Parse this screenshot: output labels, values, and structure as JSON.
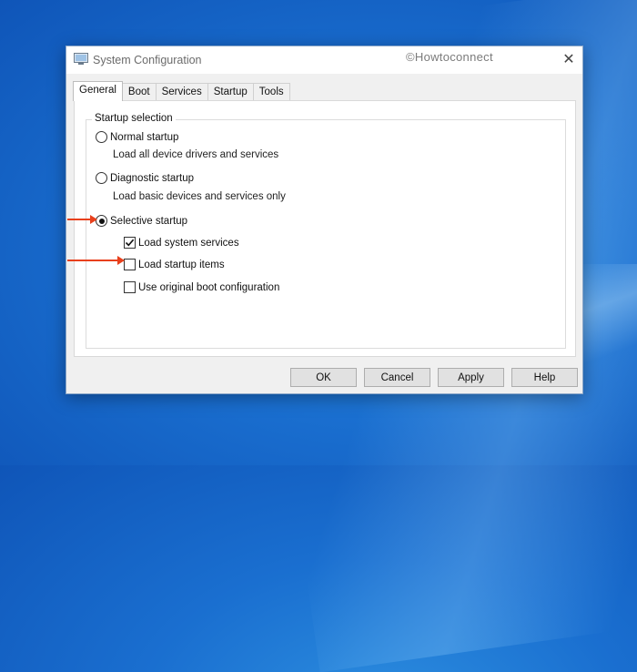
{
  "window": {
    "title": "System Configuration",
    "watermark": "©Howtoconnect",
    "close_glyph": "✕"
  },
  "tabs": [
    {
      "label": "General",
      "active": true
    },
    {
      "label": "Boot",
      "active": false
    },
    {
      "label": "Services",
      "active": false
    },
    {
      "label": "Startup",
      "active": false
    },
    {
      "label": "Tools",
      "active": false
    }
  ],
  "startup_selection": {
    "legend": "Startup selection",
    "normal": {
      "label": "Normal startup",
      "desc": "Load all device drivers and services",
      "checked": false
    },
    "diagnostic": {
      "label": "Diagnostic startup",
      "desc": "Load basic devices and services only",
      "checked": false
    },
    "selective": {
      "label": "Selective startup",
      "checked": true
    },
    "options": [
      {
        "label": "Load system services",
        "checked": true
      },
      {
        "label": "Load startup items",
        "checked": false
      },
      {
        "label": "Use original boot configuration",
        "checked": false
      }
    ]
  },
  "buttons": {
    "ok": "OK",
    "cancel": "Cancel",
    "apply": "Apply",
    "help": "Help"
  },
  "colors": {
    "arrow": "#e8401c",
    "desktop": "#1a6fd0"
  }
}
